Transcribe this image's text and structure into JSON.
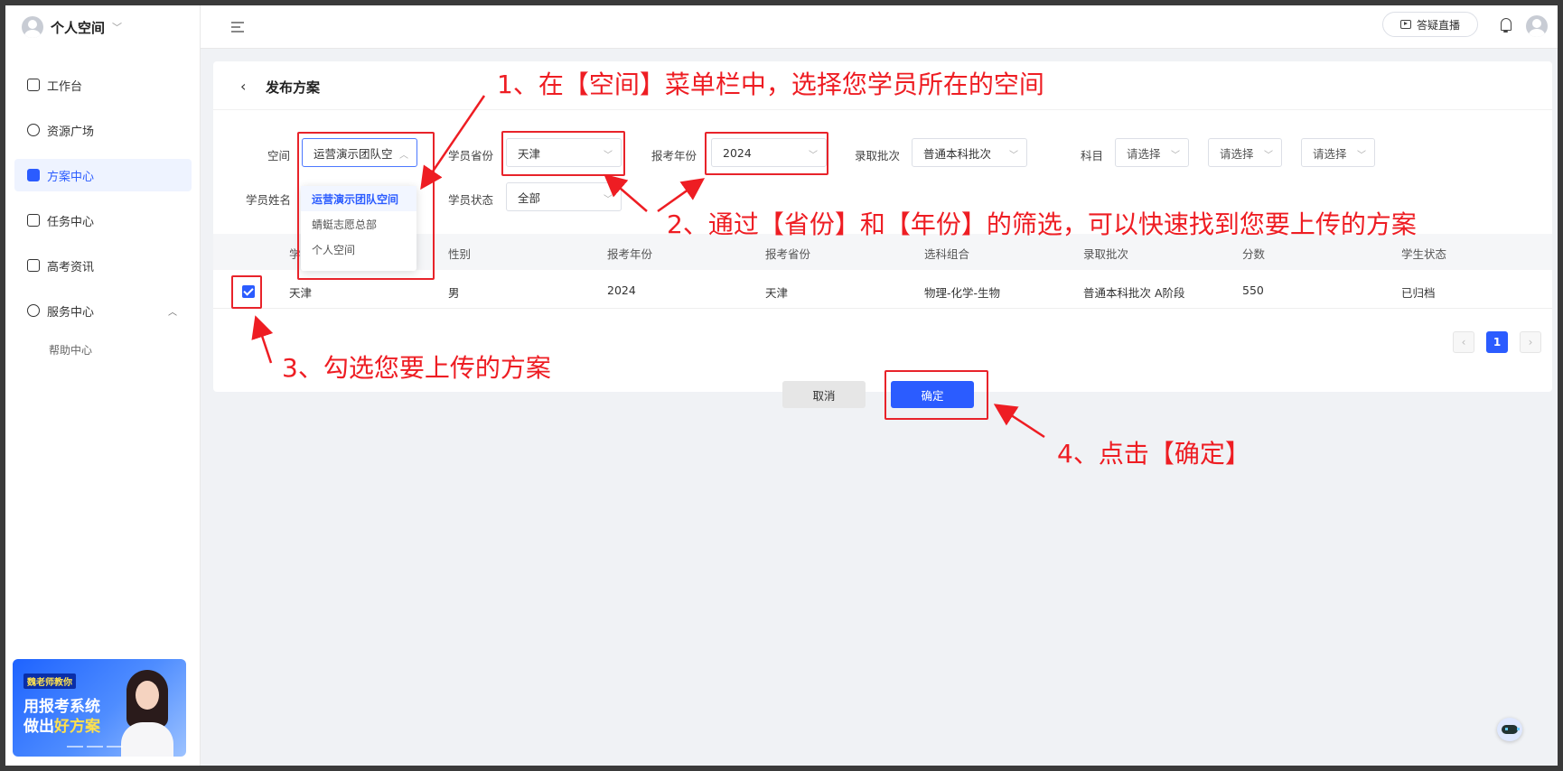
{
  "sidebar": {
    "space_name": "个人空间",
    "nav": [
      {
        "label": "工作台"
      },
      {
        "label": "资源广场"
      },
      {
        "label": "方案中心"
      },
      {
        "label": "任务中心"
      },
      {
        "label": "高考资讯"
      },
      {
        "label": "服务中心"
      }
    ],
    "sub_item": "帮助中心",
    "promo": {
      "tag": "魏老师教你",
      "line1": "用报考系统",
      "line2_a": "做出",
      "line2_b": "好方案"
    }
  },
  "topbar": {
    "live_label": "答疑直播"
  },
  "page": {
    "title": "发布方案"
  },
  "filters": {
    "space_label": "空间",
    "space_value": "运营演示团队空",
    "province_label": "学员省份",
    "province_value": "天津",
    "year_label": "报考年份",
    "year_value": "2024",
    "batch_label": "录取批次",
    "batch_value": "普通本科批次",
    "subject_label": "科目",
    "subject_placeholder": "请选择",
    "name_label": "学员姓名",
    "status_label": "学员状态",
    "status_value": "全部"
  },
  "space_dropdown": {
    "options": [
      "运营演示团队空间",
      "蜻蜓志愿总部",
      "个人空间"
    ]
  },
  "table": {
    "headers": [
      "学",
      "性别",
      "报考年份",
      "报考省份",
      "选科组合",
      "录取批次",
      "分数",
      "学生状态"
    ],
    "rows": [
      {
        "name": "天津",
        "gender": "男",
        "year": "2024",
        "province": "天津",
        "combo": "物理-化学-生物",
        "batch": "普通本科批次 A阶段",
        "score": "550",
        "status": "已归档"
      }
    ]
  },
  "pagination": {
    "prev": "‹",
    "current": "1",
    "next": "›"
  },
  "buttons": {
    "cancel": "取消",
    "confirm": "确定"
  },
  "annotations": {
    "step1": "1、在【空间】菜单栏中，选择您学员所在的空间",
    "step2": "2、通过【省份】和【年份】的筛选，可以快速找到您要上传的方案",
    "step3": "3、勾选您要上传的方案",
    "step4": "4、点击【确定】",
    "color": "#ee1d23"
  },
  "colors": {
    "primary": "#2b5cff",
    "annotation_red": "#ee1d23"
  }
}
